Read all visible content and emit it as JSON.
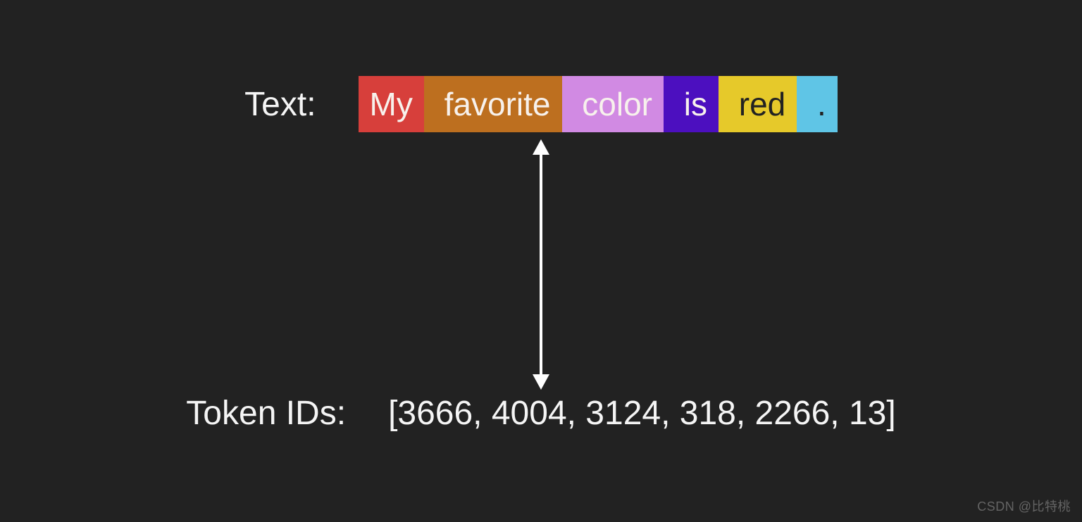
{
  "labels": {
    "text": "Text:",
    "token_ids": "Token IDs:"
  },
  "tokens": [
    {
      "text": "My",
      "bg": "#d73f3b",
      "fg": "#f7f1ec",
      "id": 3666
    },
    {
      "text": " favorite",
      "bg": "#bd6f1f",
      "fg": "#f7f1ec",
      "id": 4004
    },
    {
      "text": " color",
      "bg": "#d18ae3",
      "fg": "#f7f1ec",
      "id": 3124
    },
    {
      "text": " is",
      "bg": "#4c0fbf",
      "fg": "#f7f1ec",
      "id": 318
    },
    {
      "text": " red",
      "bg": "#e6c92a",
      "fg": "#222222",
      "id": 2266
    },
    {
      "text": " .",
      "bg": "#5fc5e6",
      "fg": "#222222",
      "id": 13
    }
  ],
  "token_ids_display": "[3666, 4004, 3124, 318, 2266, 13]",
  "watermark": "CSDN @比特桃"
}
